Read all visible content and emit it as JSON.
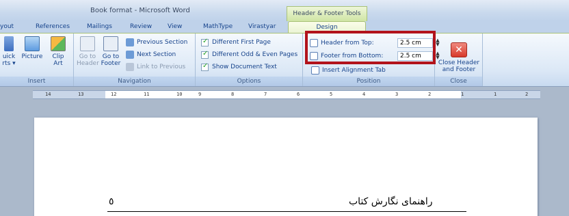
{
  "window": {
    "title": "Book format - Microsoft Word",
    "contextual_title": "Header & Footer Tools"
  },
  "tabs": {
    "layout": "yout",
    "references": "References",
    "mailings": "Mailings",
    "review": "Review",
    "view": "View",
    "mathtype": "MathType",
    "virastyar": "Virastyar",
    "design": "Design"
  },
  "groups": {
    "insert": {
      "label": "Insert",
      "quick_parts": "uick\nrts ▾",
      "picture": "Picture",
      "clip_art": "Clip\nArt"
    },
    "navigation": {
      "label": "Navigation",
      "go_to_header": "Go to\nHeader",
      "go_to_footer": "Go to\nFooter",
      "previous_section": "Previous Section",
      "next_section": "Next Section",
      "link_to_previous": "Link to Previous"
    },
    "options": {
      "label": "Options",
      "different_first_page": "Different First Page",
      "different_odd_even": "Different Odd & Even Pages",
      "show_document_text": "Show Document Text"
    },
    "position": {
      "label": "Position",
      "header_from_top_label": "Header from Top:",
      "header_from_top_value": "2.5 cm",
      "footer_from_bottom_label": "Footer from Bottom:",
      "footer_from_bottom_value": "2.5 cm",
      "insert_alignment_tab": "Insert Alignment Tab"
    },
    "close": {
      "label": "Close",
      "close_header_footer": "Close Header\nand Footer"
    }
  },
  "ruler": {
    "numbers": [
      "14",
      "13",
      "12",
      "11",
      "10",
      "9",
      "8",
      "7",
      "6",
      "5",
      "4",
      "3",
      "2",
      "1",
      "1",
      "2"
    ]
  },
  "document": {
    "page_number": "٥",
    "running_title": "راهنمای نگارش کتاب"
  },
  "colors": {
    "highlight_border": "#b2131b",
    "contextual_tab": "#cfe5a4",
    "ribbon_text": "#15428b"
  }
}
